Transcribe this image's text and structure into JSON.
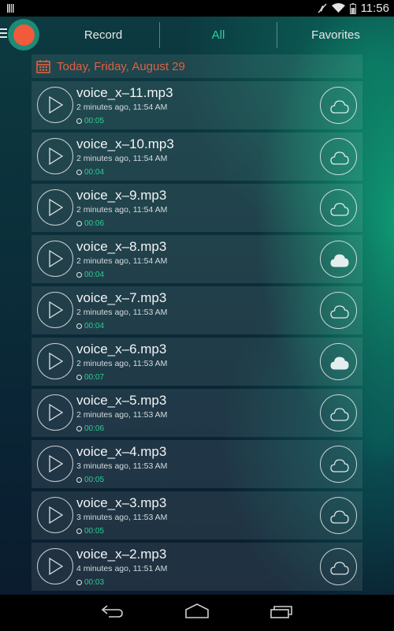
{
  "status_bar": {
    "time": "11:56",
    "icons": [
      "signal-bars-icon",
      "mute-icon",
      "wifi-icon",
      "battery-icon"
    ]
  },
  "top_bar": {
    "menu_icon": "menu-icon",
    "record_button": "record-icon",
    "tabs": [
      {
        "label": "Record",
        "active": false
      },
      {
        "label": "All",
        "active": true
      },
      {
        "label": "Favorites",
        "active": false
      }
    ]
  },
  "colors": {
    "accent": "#2dd0a0",
    "date_header": "#e0603f",
    "record_dot": "#f15a3a",
    "record_ring": "#1e8a78"
  },
  "date_header": {
    "icon": "calendar-icon",
    "label": "Today, Friday, August 29"
  },
  "recordings": [
    {
      "name": "voice_x–11.mp3",
      "meta": "2 minutes ago, 11:54 AM",
      "duration": "00:05",
      "cloud_synced": false
    },
    {
      "name": "voice_x–10.mp3",
      "meta": "2 minutes ago, 11:54 AM",
      "duration": "00:04",
      "cloud_synced": false
    },
    {
      "name": "voice_x–9.mp3",
      "meta": "2 minutes ago, 11:54 AM",
      "duration": "00:06",
      "cloud_synced": false
    },
    {
      "name": "voice_x–8.mp3",
      "meta": "2 minutes ago, 11:54 AM",
      "duration": "00:04",
      "cloud_synced": true
    },
    {
      "name": "voice_x–7.mp3",
      "meta": "2 minutes ago, 11:53 AM",
      "duration": "00:04",
      "cloud_synced": false
    },
    {
      "name": "voice_x–6.mp3",
      "meta": "2 minutes ago, 11:53 AM",
      "duration": "00:07",
      "cloud_synced": true
    },
    {
      "name": "voice_x–5.mp3",
      "meta": "2 minutes ago, 11:53 AM",
      "duration": "00:06",
      "cloud_synced": false
    },
    {
      "name": "voice_x–4.mp3",
      "meta": "3 minutes ago, 11:53 AM",
      "duration": "00:05",
      "cloud_synced": false
    },
    {
      "name": "voice_x–3.mp3",
      "meta": "3 minutes ago, 11:53 AM",
      "duration": "00:05",
      "cloud_synced": false
    },
    {
      "name": "voice_x–2.mp3",
      "meta": "4 minutes ago, 11:51 AM",
      "duration": "00:03",
      "cloud_synced": false
    }
  ],
  "nav_bar": {
    "buttons": [
      "back-icon",
      "home-icon",
      "recents-icon"
    ]
  }
}
